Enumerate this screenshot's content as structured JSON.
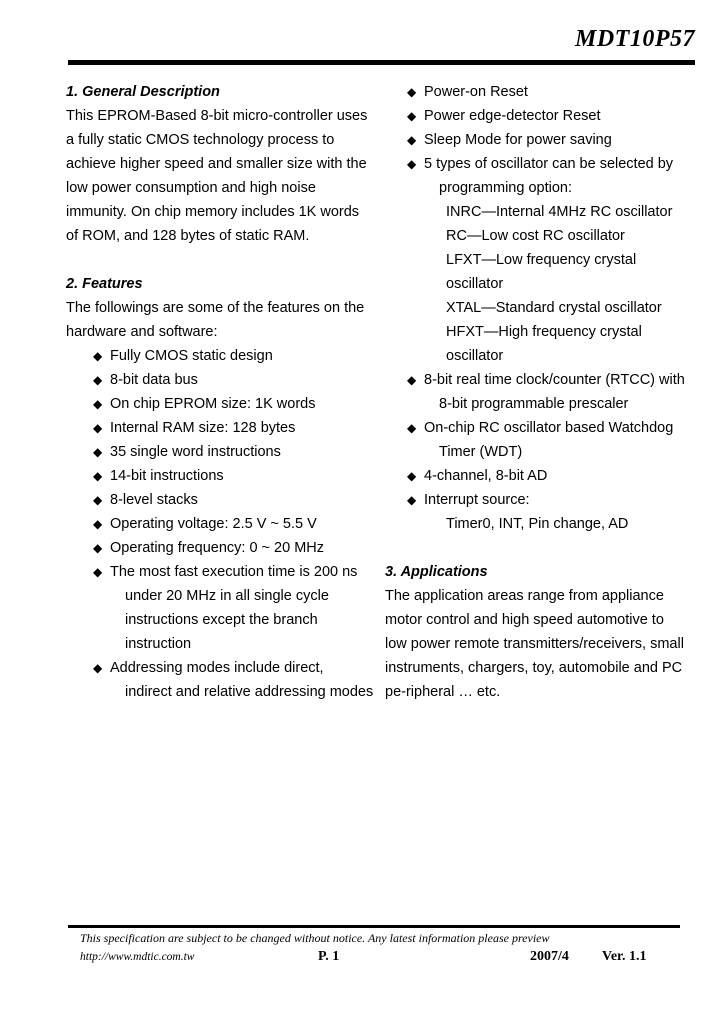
{
  "header": {
    "title": "MDT10P57"
  },
  "bullet_glyph": "◆",
  "left_column": {
    "section1": {
      "heading": "1. General Description",
      "lines": [
        "This EPROM-Based 8-bit micro-controller uses",
        "a fully static CMOS technology process to",
        "achieve higher speed and smaller size with the",
        "low power consumption and high noise",
        "immunity. On chip memory includes 1K words",
        "of ROM, and 128 bytes of static RAM."
      ]
    },
    "section2": {
      "heading": "2. Features",
      "lines": [
        "The followings are some of the features on the",
        "hardware and software:"
      ],
      "items": [
        {
          "lines": [
            "Fully CMOS static design"
          ]
        },
        {
          "lines": [
            "8-bit data bus"
          ]
        },
        {
          "lines": [
            "On chip EPROM size: 1K words"
          ]
        },
        {
          "lines": [
            "Internal RAM size: 128 bytes"
          ]
        },
        {
          "lines": [
            "35 single word instructions"
          ]
        },
        {
          "lines": [
            "14-bit instructions"
          ]
        },
        {
          "lines": [
            "8-level stacks"
          ]
        },
        {
          "lines": [
            "Operating voltage: 2.5 V ~ 5.5 V"
          ]
        },
        {
          "lines": [
            "Operating frequency: 0 ~ 20 MHz"
          ]
        },
        {
          "lines": [
            "The most fast execution time is 200 ns",
            "under 20 MHz in all single cycle",
            "instructions except the branch",
            "instruction"
          ]
        },
        {
          "lines": [
            "Addressing modes include direct,",
            "indirect and relative addressing modes"
          ]
        }
      ]
    }
  },
  "right_column": {
    "features_continued": [
      {
        "lines": [
          "Power-on Reset"
        ]
      },
      {
        "lines": [
          "Power edge-detector Reset"
        ]
      },
      {
        "lines": [
          "Sleep Mode for power saving"
        ]
      },
      {
        "lines": [
          "5 types of oscillator can be selected by",
          "programming option:"
        ],
        "sublist": [
          "INRC—Internal 4MHz RC oscillator",
          "RC—Low cost RC oscillator",
          "LFXT—Low frequency crystal",
          "oscillator",
          "XTAL—Standard crystal oscillator",
          "HFXT—High frequency crystal",
          "oscillator"
        ]
      },
      {
        "lines": [
          "8-bit real time clock/counter (RTCC) with",
          "8-bit programmable prescaler"
        ]
      },
      {
        "lines": [
          "On-chip RC oscillator based Watchdog",
          "Timer (WDT)"
        ]
      },
      {
        "lines": [
          "4-channel, 8-bit AD"
        ]
      },
      {
        "lines": [
          "Interrupt source:"
        ],
        "sublist": [
          "Timer0, INT, Pin change, AD"
        ]
      }
    ],
    "section3": {
      "heading": "3. Applications",
      "lines": [
        "The application areas range from appliance",
        "motor control and high speed automotive to",
        "low power remote transmitters/receivers, small",
        "instruments, chargers, toy, automobile and PC",
        "pe-ripheral … etc."
      ]
    }
  },
  "footer": {
    "note": "This specification are subject to be changed without notice. Any latest information please preview",
    "url": "http://www.mdtic.com.tw",
    "page": "P. 1",
    "date": "2007/4",
    "version": "Ver. 1.1"
  }
}
